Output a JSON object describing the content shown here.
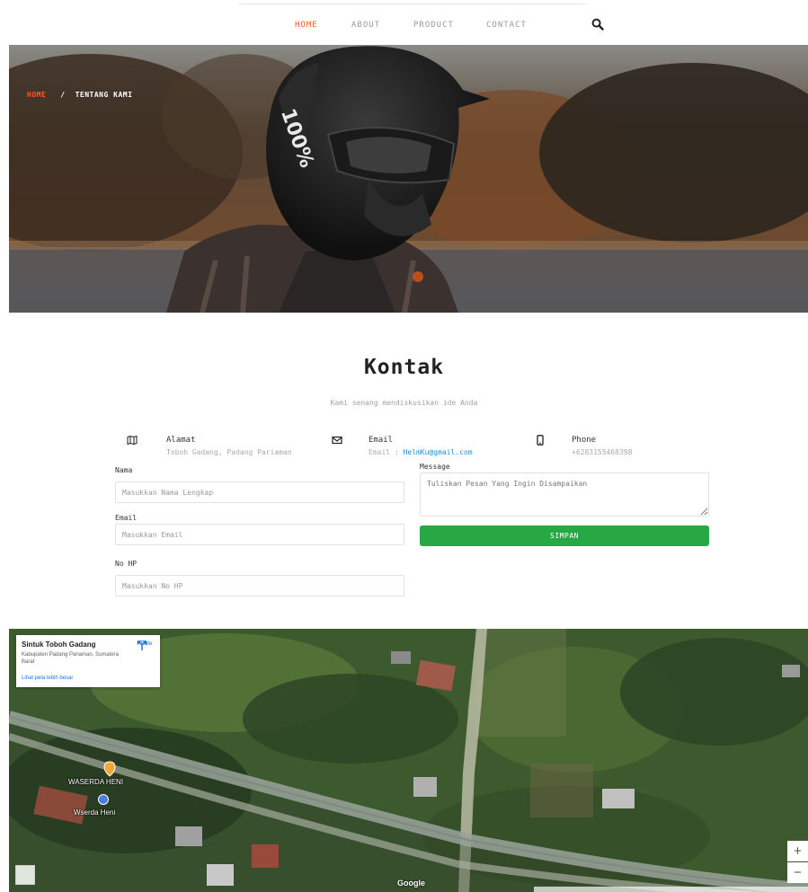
{
  "nav": {
    "items": [
      {
        "label": "HOME",
        "active": true
      },
      {
        "label": "ABOUT",
        "active": false
      },
      {
        "label": "PRODUCT",
        "active": false
      },
      {
        "label": "CONTACT",
        "active": false
      }
    ],
    "search_icon": "search-icon"
  },
  "hero": {
    "breadcrumb": {
      "home": "HOME",
      "separator": "/",
      "current": "TENTANG KAMI"
    }
  },
  "contact": {
    "title": "Kontak",
    "subtitle": "Kami senang mendiskusikan ide Anda",
    "info": {
      "address": {
        "icon": "map-icon",
        "label": "Alamat",
        "value": "Toboh Gadang, Padang Pariaman"
      },
      "email": {
        "icon": "envelope-icon",
        "label": "Email",
        "prefix": "Email : ",
        "value": "HelmKu@gmail.com"
      },
      "phone": {
        "icon": "mobile-icon",
        "label": "Phone",
        "value": "+6283155468398"
      }
    },
    "form": {
      "name": {
        "label": "Nama",
        "placeholder": "Masukkan Nama Lengkap",
        "value": ""
      },
      "email": {
        "label": "Email",
        "placeholder": "Masukkan Email",
        "value": ""
      },
      "phone": {
        "label": "No HP",
        "placeholder": "Masukkan No HP",
        "value": ""
      },
      "message": {
        "label": "Message",
        "placeholder": "Tuliskan Pesan Yang Ingin Disampaikan",
        "value": ""
      },
      "submit_label": "SIMPAN"
    }
  },
  "map": {
    "place_name": "Sintuk Toboh Gadang",
    "place_address": "Kabupaten Padang Pariaman, Sumatera Barat",
    "route_label": "Rute",
    "larger_map_link": "Lihat peta lebih besar",
    "poi": [
      "WASERDA HENI",
      "Wserda Heni"
    ],
    "zoom_in": "+",
    "zoom_out": "−",
    "logo": "Google"
  },
  "colors": {
    "accent": "#ff5a1f",
    "submit": "#28a745",
    "link": "#1d8fe1"
  }
}
